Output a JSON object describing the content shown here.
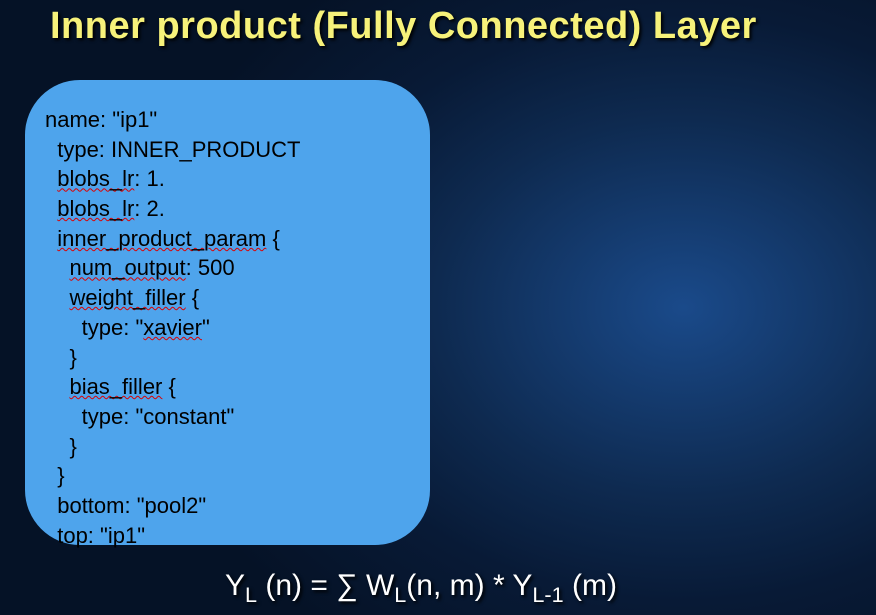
{
  "title": "Inner product  (Fully Connected)  Layer",
  "code": {
    "l1a": "name: \"ip1\"",
    "l2a": "  type: INNER_PRODUCT",
    "l3a": "  ",
    "l3b": "blobs_lr",
    "l3c": ": 1.",
    "l4a": "  ",
    "l4b": "blobs_lr",
    "l4c": ": 2.",
    "l5a": "  ",
    "l5b": "inner_product_param",
    "l5c": " {",
    "l6a": "    ",
    "l6b": "num_output",
    "l6c": ": 500",
    "l7a": "    ",
    "l7b": "weight_filler",
    "l7c": " {",
    "l8a": "      type: \"",
    "l8b": "xavier",
    "l8c": "\"",
    "l9a": "    }",
    "l10a": "    ",
    "l10b": "bias_filler",
    "l10c": " {",
    "l11a": "      type: \"constant\"",
    "l12a": "    }",
    "l13a": "  }",
    "l14a": "  bottom: \"pool2\"",
    "l15a": "  top: \"ip1\""
  },
  "formula": {
    "p1": "Y",
    "s1": "L",
    "p2": " (n) = ∑ W",
    "s2": "L",
    "p3": "(n, m) * Y",
    "s3": "L-1",
    "p4": " (m)"
  }
}
